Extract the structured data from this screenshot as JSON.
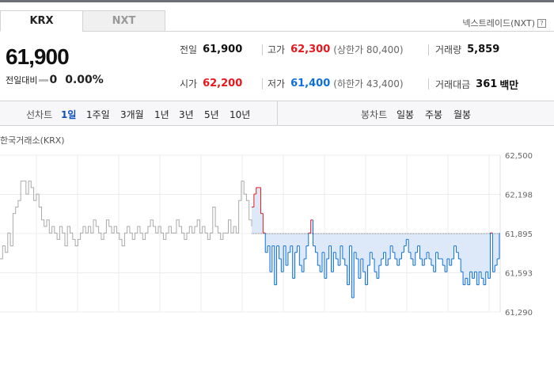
{
  "tabs": [
    {
      "label": "KRX",
      "active": true
    },
    {
      "label": "NXT",
      "active": false
    }
  ],
  "nxt_link": "넥스트레이드(NXT)",
  "price": "61,900",
  "change": {
    "label": "전일대비",
    "value": "0",
    "percent": "0.00%"
  },
  "stats": {
    "prev": {
      "label": "전일",
      "value": "61,900"
    },
    "high": {
      "label": "고가",
      "value": "62,300",
      "limit_label": "(상한가 80,400)"
    },
    "volume": {
      "label": "거래량",
      "value": "5,859"
    },
    "open": {
      "label": "시가",
      "value": "62,200"
    },
    "low": {
      "label": "저가",
      "value": "61,400",
      "limit_label": "(하한가 43,400)"
    },
    "amount": {
      "label": "거래대금",
      "value": "361",
      "unit": "백만"
    }
  },
  "periods": {
    "line_label": "선차트",
    "line_items": [
      "1일",
      "1주일",
      "3개월",
      "1년",
      "3년",
      "5년",
      "10년"
    ],
    "active": "1일",
    "candle_label": "봉차트",
    "candle_items": [
      "일봉",
      "주봉",
      "월봉"
    ]
  },
  "colors": {
    "up": "#e8171b",
    "down": "#0e6fdc",
    "inactive_line": "#aaaaaa",
    "fill": "#dde9f8"
  },
  "chart_data": {
    "type": "line",
    "title": "한국거래소(KRX)",
    "ylim": [
      61290,
      62500
    ],
    "yticks": [
      "62,500",
      "62,198",
      "61,895",
      "61,593",
      "61,290"
    ],
    "reference": 61895,
    "series": [
      {
        "values": [
          61700,
          61800,
          61750,
          61900,
          61800,
          62050,
          62100,
          62150,
          62300,
          62300,
          62200,
          62300,
          62250,
          62150,
          62200,
          62100,
          62000,
          61950,
          62000,
          61900,
          61950,
          61900,
          61850,
          61950,
          61900,
          61800,
          61950,
          61900,
          61850,
          61800,
          61850,
          61900,
          61950,
          61900,
          61950,
          61900,
          62000,
          61950,
          61900,
          61850,
          61900,
          62000,
          61950,
          61900,
          61950,
          61900,
          61850,
          61800,
          61900,
          61950,
          61900,
          61850,
          61900,
          61950,
          61900,
          61850,
          61900,
          61950,
          62000,
          61950,
          61900,
          61950,
          61900,
          61850,
          61900,
          61950,
          61900,
          61900,
          62000,
          61950,
          61900,
          61850,
          61900,
          61950,
          61900,
          61950,
          62000,
          61900,
          61950,
          61900,
          61850,
          61900,
          62100,
          61950,
          61900,
          61850,
          61900,
          61900,
          62000,
          61900,
          61950,
          61900,
          62150,
          62300,
          62200,
          62150,
          62000,
          61950
        ]
      },
      {
        "values": [
          62100,
          62200,
          62250,
          62250,
          62050,
          61900,
          61750,
          61800,
          61600,
          61800,
          61500,
          61800,
          61700,
          61600,
          61800,
          61650,
          61750,
          61800,
          61550,
          61750,
          61800,
          61650,
          61600,
          61700,
          61800,
          61900,
          62000,
          61800,
          61750,
          61650,
          61600,
          61750,
          61550,
          61700,
          61800,
          61600,
          61750,
          61700,
          61650,
          61800,
          61700,
          61650,
          61500,
          61800,
          61400,
          61750,
          61700,
          61550,
          61700,
          61600,
          61500,
          61650,
          61750,
          61700,
          61600,
          61550,
          61650,
          61700,
          61750,
          61650,
          61700,
          61800,
          61750,
          61700,
          61650,
          61700,
          61750,
          61800,
          61850,
          61750,
          61700,
          61650,
          61750,
          61800,
          61700,
          61650,
          61700,
          61750,
          61700,
          61650,
          61600,
          61750,
          61700,
          61700,
          61650,
          61600,
          61700,
          61650,
          61700,
          61800,
          61750,
          61700,
          61600,
          61500,
          61550,
          61500,
          61600,
          61550,
          61600,
          61500,
          61600,
          61550,
          61500,
          61600,
          61550,
          61900,
          61600,
          61650,
          61700,
          61900
        ]
      }
    ]
  }
}
